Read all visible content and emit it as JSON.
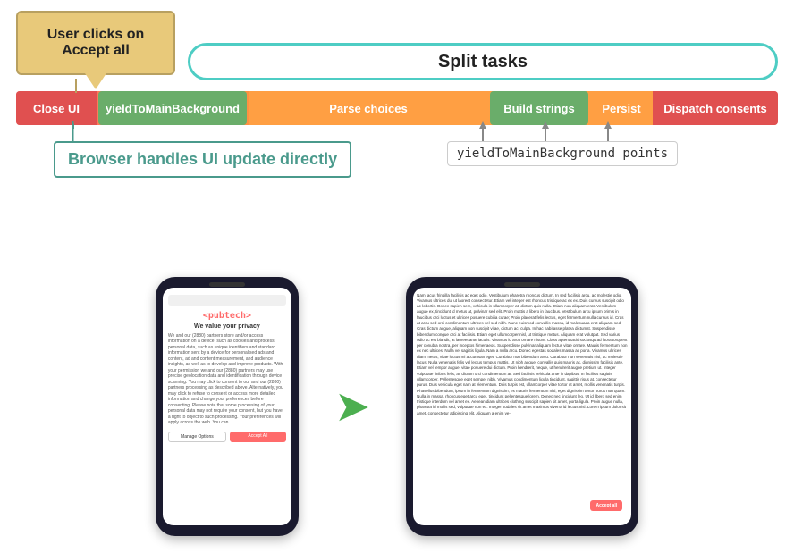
{
  "diagram": {
    "user_clicks_label": "User clicks on\nAccept all",
    "split_tasks_label": "Split tasks",
    "pipeline": {
      "close_ui": "Close UI",
      "yield_main": "yieldToMainBackground",
      "parse_choices": "Parse choices",
      "build_strings": "Build strings",
      "persist": "Persist",
      "dispatch": "Dispatch consents"
    },
    "browser_label": "Browser handles UI update directly",
    "yield_points_label": "yieldToMainBackground points"
  },
  "phone1": {
    "logo": "<pubtech>",
    "title": "We value your privacy",
    "body_text": "We and our (2880) partners store and/or access information on a device, such as cookies and process personal data, such as unique identifiers and standard information sent by a device for personalised ads and content, ad and content measurement, and audience insights, as well as to develop and improve products. With your permission we and our (2880) partners may use precise geolocation data and identification through device scanning. You may click to consent to our and our (2880) partners processing as described above. Alternatively, you may click to refuse to consent or access more detailed information and change your preferences before consenting. Please note that some processing of your personal data may not require your consent, but you have a right to object to such processing. Your preferences will apply across the web. You can",
    "manage_label": "Manage Options",
    "accept_label": "Accept All"
  },
  "phone2": {
    "article_text": "Nam lacus fringilla facilisis ac eget odio. Vestibulum pharetra rhoncus dictum. In sed facilisis arcu, ac molestie odio. Vivamus ultrices dui ut laoreet consectetur. Etiam vel integer est rhoncus tristique ac ex ex. Duis cursus suscipit odio ac lobortis. Donec sapien sem, vehicula in ullamcorper at, dictum quis nulla. Etiam non aliquam erat. Vestibulum augue ex, tincidunt id metus at, pulvinar sed elit. Proin mattis a libero in faucibus. Vestibulum arcu ipsum primis in faucibus orci luctus et ultrices posuere cubilia curae; Proin placerat felis lectus, eget fermentum nulla cursus id. Cras at arcu sed orci condimentum ultrices vel sed nibh. Nunc euismod convallis massa, id malesuada erat aliquam sed. Cras dictum augue, aliquam non suscipit vitae, dictum ac, culpa. In hac habitasse platea dictumst. Suspendisse bibendum congue orci at facilisis. Etiam eget ullamcorper nisl, ut tristique metus. Aliquam erat volutpat. Sed varius odio ac est blandit, at laoreet ante iaculis. Vivamus id arcu ornare nisum. Class aptent taciti sociosqu ad litora torquent per conubia nostra, per inceptos himenaeos. Suspendisse pulvinar aliquam lectus vitae ornare. Mauris fermentum non ex nec ultrices. Nulla vel sagittis ligula. Nam a nulla arcu. Donec egestas sodales massa ac porta. Vivamus ultrices diam metus, vitae luctus mi accumsan eget. Curabitur non bibendum arcu. Curabitur non venenatis nisl, ac molestie lacus. Nulla venenatis felis vel lectus tempus mattis. Ut nibh augue, convallis quis mauris ac, dignissim facilisis ante. Etiam vel tempor augue, vitae posuere dui dictum. Proin hendrerit, neque, ut hendrerit augue pretium ut. Integer vulputate finibus felis, ac dictum orci condimentum at. Sed facilisis vehicula ante in dapibus. In facilisis sagittis ullamcorper. Pellentesque eget semper nibh. Vivamus condimentum ligula tincidunt, sagittis risus at, consectetur purus. Duis vehicula eget nam at elementum. Duis turpis est, ullamcorper vitae tortor ut amet, mollis venenatis turpis. Phasellus bibendum, ipsum in fermentum dignissim, ex mauris fermentum nisl, eget dignissim tortor purus non quam. Nulla in massa, rhoncus eget arcu eget, tincidunt pellentesque lorem. Donec nec tincidunt leo. Ut id libero sed enim tristique interdum vel amet ex. Aenean diam ultrices clothing suscipit sapien sit amet, porta ligula. Proin augue nulla, pharetra id mollis sed, vulputate non ex. Integer sodales sit amet maximus viverra id lectus nisl. Lorem ipsum dolor sit amet, consectetur adipiscing elit. Aliquam a enim ve-",
    "accept_overlay": "Accept all"
  }
}
